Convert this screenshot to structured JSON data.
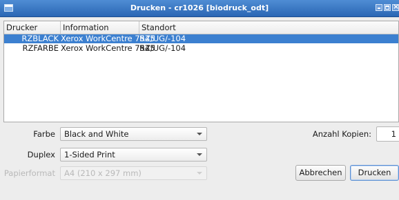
{
  "window": {
    "title": "Drucken - cr1026 [biodruck_odt]"
  },
  "printer_list": {
    "columns": [
      "Drucker",
      "Information",
      "Standort"
    ],
    "rows": [
      {
        "name": "RZBLACK",
        "info": "Xerox WorkCentre 7545",
        "location": "RZ/UG/-104",
        "selected": true
      },
      {
        "name": "RZFARBE",
        "info": "Xerox WorkCentre 7545",
        "location": "RZ/UG/-104",
        "selected": false
      }
    ]
  },
  "options": {
    "color_label": "Farbe",
    "color_value": "Black and White",
    "duplex_label": "Duplex",
    "duplex_value": "1-Sided Print",
    "paper_label": "Papierformat",
    "paper_value": "A4 (210 x 297 mm)",
    "copies_label": "Anzahl Kopien:",
    "copies_value": "1"
  },
  "buttons": {
    "cancel": "Abbrechen",
    "print": "Drucken"
  },
  "colors": {
    "titlebar": "#2a66b4",
    "selection": "#3c80d0"
  }
}
